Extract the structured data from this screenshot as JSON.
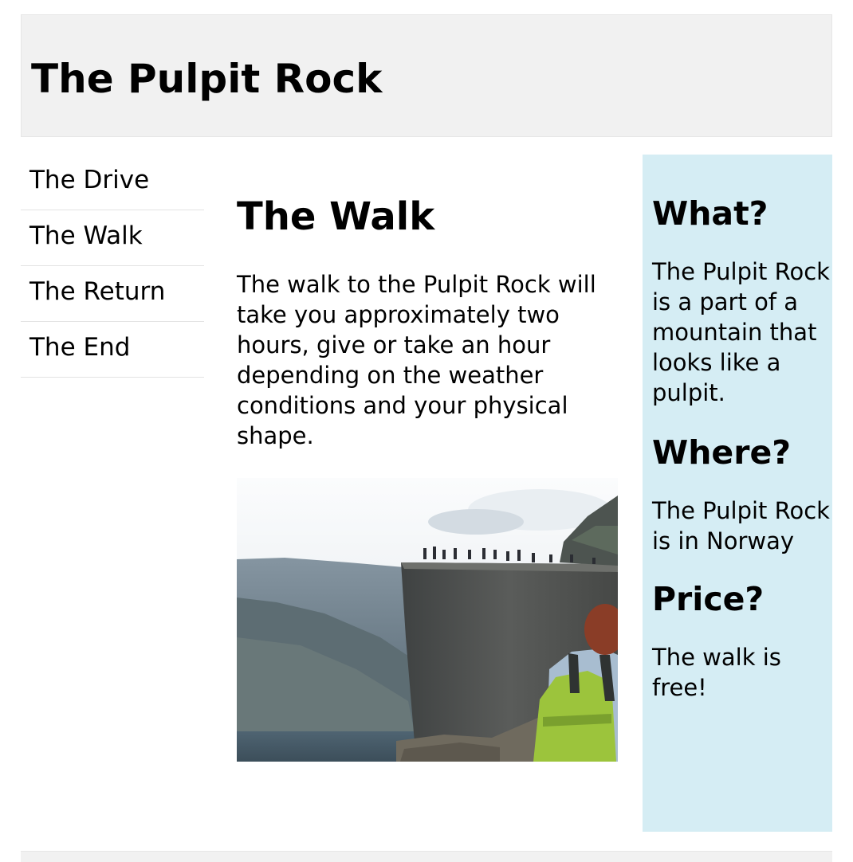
{
  "header": {
    "title": "The Pulpit Rock"
  },
  "nav": {
    "items": [
      {
        "label": "The Drive"
      },
      {
        "label": "The Walk"
      },
      {
        "label": "The Return"
      },
      {
        "label": "The End"
      }
    ]
  },
  "main": {
    "heading": "The Walk",
    "paragraph": "The walk to the Pulpit Rock will take you approximately two hours, give or take an hour depending on the weather conditions and your physical shape."
  },
  "aside": {
    "sections": [
      {
        "heading": "What?",
        "text": "The Pulpit Rock is a part of a mountain that looks like a pulpit."
      },
      {
        "heading": "Where?",
        "text": "The Pulpit Rock is in Norway"
      },
      {
        "heading": "Price?",
        "text": "The walk is free!"
      }
    ],
    "background": "#d5edf4"
  },
  "colors": {
    "header_bg": "#f1f1f1",
    "aside_bg": "#d5edf4"
  }
}
